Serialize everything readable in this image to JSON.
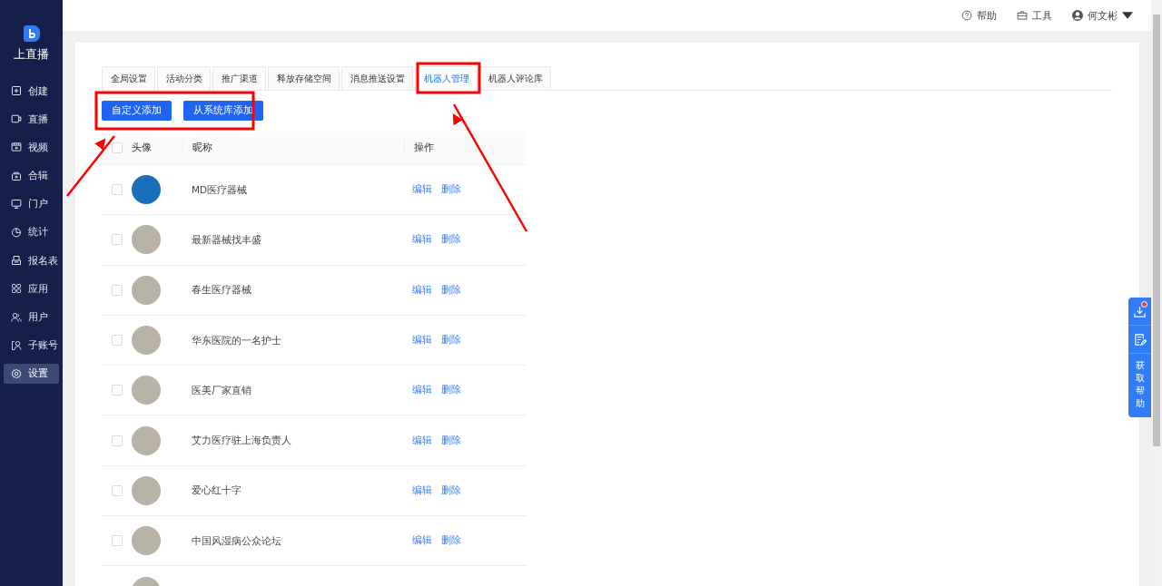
{
  "sidebar": {
    "logo_text": "上直播",
    "items": [
      {
        "label": "创建",
        "selected": false
      },
      {
        "label": "直播",
        "selected": false
      },
      {
        "label": "视频",
        "selected": false
      },
      {
        "label": "合辑",
        "selected": false
      },
      {
        "label": "门户",
        "selected": false
      },
      {
        "label": "统计",
        "selected": false
      },
      {
        "label": "报名表",
        "selected": false
      },
      {
        "label": "应用",
        "selected": false
      },
      {
        "label": "用户",
        "selected": false
      },
      {
        "label": "子账号",
        "selected": false
      },
      {
        "label": "设置",
        "selected": true
      }
    ]
  },
  "header": {
    "help": "帮助",
    "tools": "工具",
    "user": "何文彬"
  },
  "tabs": [
    {
      "label": "全局设置",
      "selected": false
    },
    {
      "label": "活动分类",
      "selected": false
    },
    {
      "label": "推广渠道",
      "selected": false
    },
    {
      "label": "释放存储空间",
      "selected": false
    },
    {
      "label": "消息推送设置",
      "selected": false
    },
    {
      "label": "机器人管理",
      "selected": true
    },
    {
      "label": "机器人评论库",
      "selected": false
    }
  ],
  "buttons": [
    "自定义添加",
    "从系统库添加"
  ],
  "table": {
    "all_checked": false,
    "columns": [
      "头像",
      "昵称",
      "操作"
    ],
    "rows": [
      {
        "nickname": "MD医疗器械",
        "checked": false,
        "actions": [
          "编辑",
          "删除"
        ]
      },
      {
        "nickname": "最新器械找丰盛",
        "checked": false,
        "actions": [
          "编辑",
          "删除"
        ]
      },
      {
        "nickname": "春生医疗器械",
        "checked": false,
        "actions": [
          "编辑",
          "删除"
        ]
      },
      {
        "nickname": "华东医院的一名护士",
        "checked": false,
        "actions": [
          "编辑",
          "删除"
        ]
      },
      {
        "nickname": "医美厂家直销",
        "checked": false,
        "actions": [
          "编辑",
          "删除"
        ]
      },
      {
        "nickname": "艾力医疗驻上海负责人",
        "checked": false,
        "actions": [
          "编辑",
          "删除"
        ]
      },
      {
        "nickname": "爱心红十字",
        "checked": false,
        "actions": [
          "编辑",
          "删除"
        ]
      },
      {
        "nickname": "中国风湿病公众论坛",
        "checked": false,
        "actions": [
          "编辑",
          "删除"
        ]
      },
      {}
    ]
  },
  "float_panel": {
    "help_text": "获取帮助",
    "download_badge": true
  }
}
